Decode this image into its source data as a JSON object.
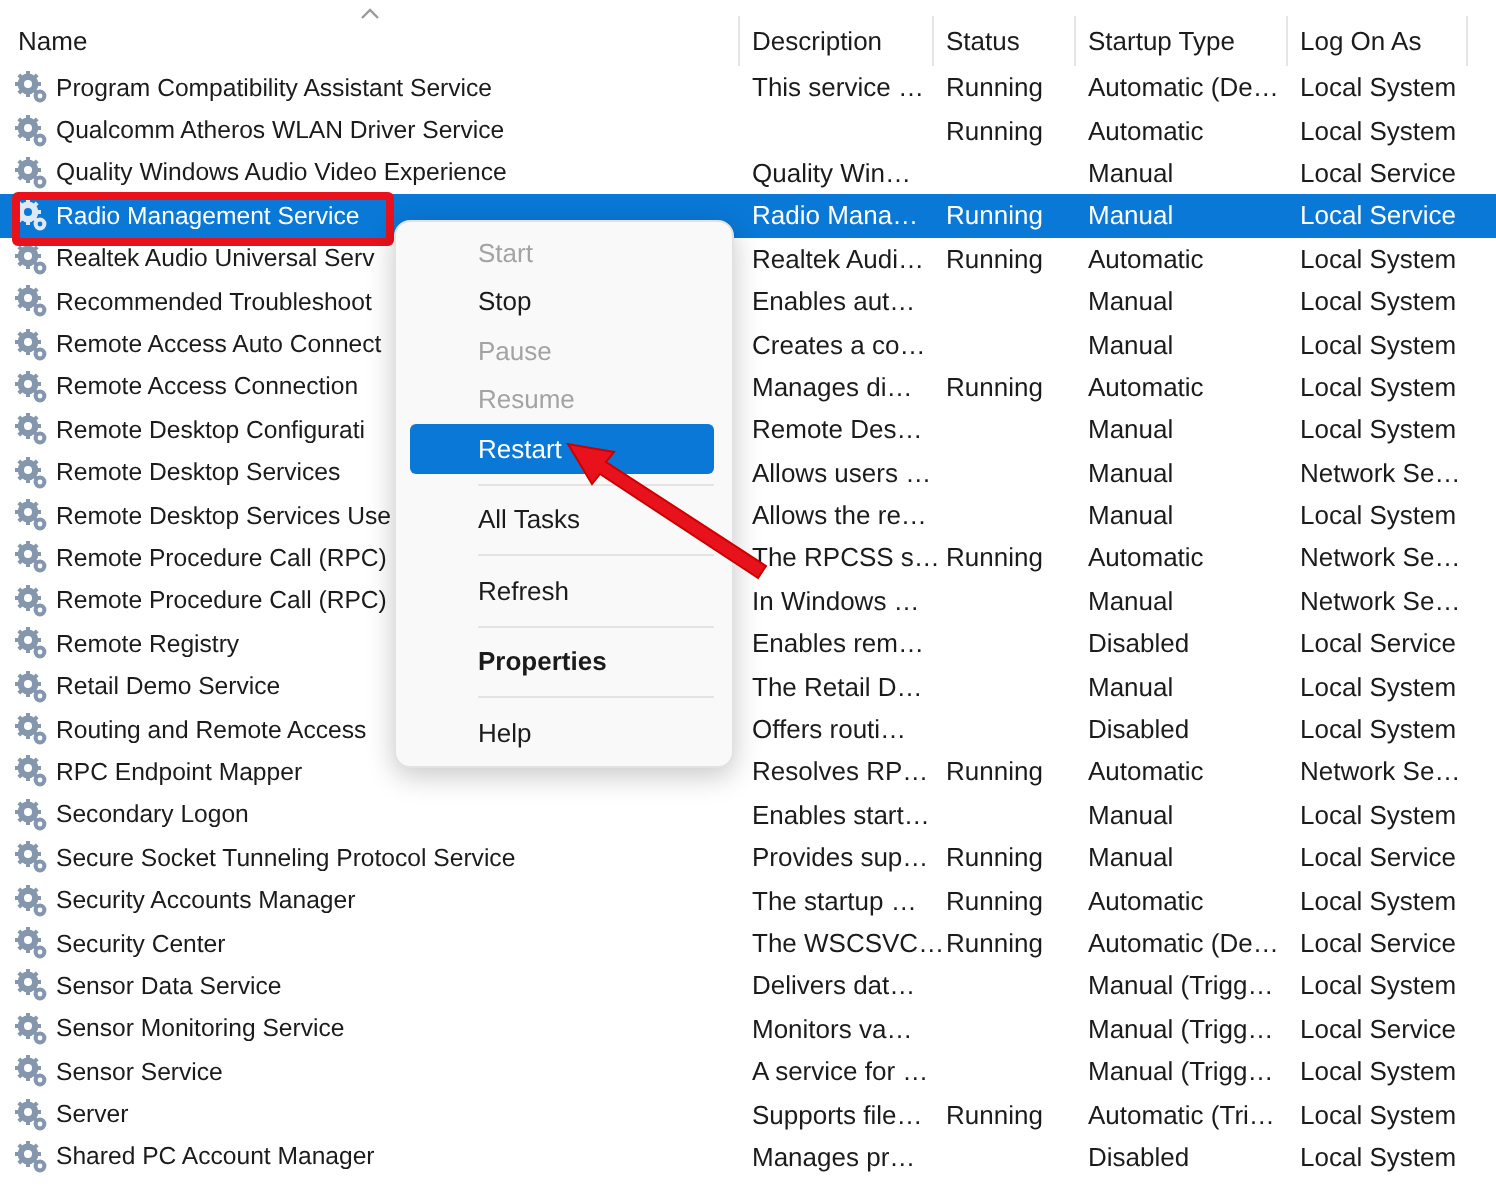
{
  "table": {
    "columns": [
      "Name",
      "Description",
      "Status",
      "Startup Type",
      "Log On As"
    ],
    "rows": [
      {
        "name": "Program Compatibility Assistant Service",
        "description": "This service …",
        "status": "Running",
        "startup_type": "Automatic (De…",
        "log_on_as": "Local System",
        "selected": false
      },
      {
        "name": "Qualcomm Atheros WLAN Driver Service",
        "status": "Running",
        "startup_type": "Automatic",
        "log_on_as": "Local System",
        "selected": false
      },
      {
        "name": "Quality Windows Audio Video Experience",
        "description": "Quality Win…",
        "startup_type": "Manual",
        "log_on_as": "Local Service",
        "selected": false
      },
      {
        "name": "Radio Management Service",
        "description": "Radio Mana…",
        "status": "Running",
        "startup_type": "Manual",
        "log_on_as": "Local Service",
        "selected": true
      },
      {
        "name": "Realtek Audio Universal Serv",
        "description": "Realtek Audi…",
        "status": "Running",
        "startup_type": "Automatic",
        "log_on_as": "Local System",
        "selected": false
      },
      {
        "name": "Recommended Troubleshoot",
        "description": "Enables aut…",
        "startup_type": "Manual",
        "log_on_as": "Local System",
        "selected": false
      },
      {
        "name": "Remote Access Auto Connect",
        "description": "Creates a co…",
        "startup_type": "Manual",
        "log_on_as": "Local System",
        "selected": false
      },
      {
        "name": "Remote Access Connection",
        "description": "Manages di…",
        "status": "Running",
        "startup_type": "Automatic",
        "log_on_as": "Local System",
        "selected": false
      },
      {
        "name": "Remote Desktop Configurati",
        "description": "Remote Des…",
        "startup_type": "Manual",
        "log_on_as": "Local System",
        "selected": false
      },
      {
        "name": "Remote Desktop Services",
        "description": "Allows users …",
        "startup_type": "Manual",
        "log_on_as": "Network Se…",
        "selected": false
      },
      {
        "name": "Remote Desktop Services Use",
        "description": "Allows the re…",
        "startup_type": "Manual",
        "log_on_as": "Local System",
        "selected": false
      },
      {
        "name": "Remote Procedure Call (RPC)",
        "description": "The RPCSS s…",
        "status": "Running",
        "startup_type": "Automatic",
        "log_on_as": "Network Se…",
        "selected": false
      },
      {
        "name": "Remote Procedure Call (RPC)",
        "description": "In Windows …",
        "startup_type": "Manual",
        "log_on_as": "Network Se…",
        "selected": false
      },
      {
        "name": "Remote Registry",
        "description": "Enables rem…",
        "startup_type": "Disabled",
        "log_on_as": "Local Service",
        "selected": false
      },
      {
        "name": "Retail Demo Service",
        "description": "The Retail D…",
        "startup_type": "Manual",
        "log_on_as": "Local System",
        "selected": false
      },
      {
        "name": "Routing and Remote Access",
        "description": "Offers routi…",
        "startup_type": "Disabled",
        "log_on_as": "Local System",
        "selected": false
      },
      {
        "name": "RPC Endpoint Mapper",
        "description": "Resolves RP…",
        "status": "Running",
        "startup_type": "Automatic",
        "log_on_as": "Network Se…",
        "selected": false
      },
      {
        "name": "Secondary Logon",
        "description": "Enables start…",
        "startup_type": "Manual",
        "log_on_as": "Local System",
        "selected": false
      },
      {
        "name": "Secure Socket Tunneling Protocol Service",
        "description": "Provides sup…",
        "status": "Running",
        "startup_type": "Manual",
        "log_on_as": "Local Service",
        "selected": false
      },
      {
        "name": "Security Accounts Manager",
        "description": "The startup …",
        "status": "Running",
        "startup_type": "Automatic",
        "log_on_as": "Local System",
        "selected": false
      },
      {
        "name": "Security Center",
        "description": "The WSCSVC…",
        "status": "Running",
        "startup_type": "Automatic (De…",
        "log_on_as": "Local Service",
        "selected": false
      },
      {
        "name": "Sensor Data Service",
        "description": "Delivers dat…",
        "startup_type": "Manual (Trigg…",
        "log_on_as": "Local System",
        "selected": false
      },
      {
        "name": "Sensor Monitoring Service",
        "description": "Monitors va…",
        "startup_type": "Manual (Trigg…",
        "log_on_as": "Local Service",
        "selected": false
      },
      {
        "name": "Sensor Service",
        "description": "A service for …",
        "startup_type": "Manual (Trigg…",
        "log_on_as": "Local System",
        "selected": false
      },
      {
        "name": "Server",
        "description": "Supports file…",
        "status": "Running",
        "startup_type": "Automatic (Tri…",
        "log_on_as": "Local System",
        "selected": false
      },
      {
        "name": "Shared PC Account Manager",
        "description": "Manages pr…",
        "startup_type": "Disabled",
        "log_on_as": "Local System",
        "selected": false
      }
    ]
  },
  "context_menu": {
    "items": [
      {
        "label": "Start",
        "disabled": true,
        "highlighted": false
      },
      {
        "label": "Stop",
        "disabled": false,
        "highlighted": false
      },
      {
        "label": "Pause",
        "disabled": true,
        "highlighted": false
      },
      {
        "label": "Resume",
        "disabled": true,
        "highlighted": false
      },
      {
        "label": "Restart",
        "disabled": false,
        "highlighted": true,
        "separator_after": true
      },
      {
        "label": "All Tasks",
        "disabled": false,
        "highlighted": false,
        "separator_after": true
      },
      {
        "label": "Refresh",
        "disabled": false,
        "highlighted": false,
        "separator_after": true
      },
      {
        "label": "Properties",
        "disabled": false,
        "highlighted": false,
        "bold": true,
        "separator_after": true
      },
      {
        "label": "Help",
        "disabled": false,
        "highlighted": false
      }
    ]
  }
}
